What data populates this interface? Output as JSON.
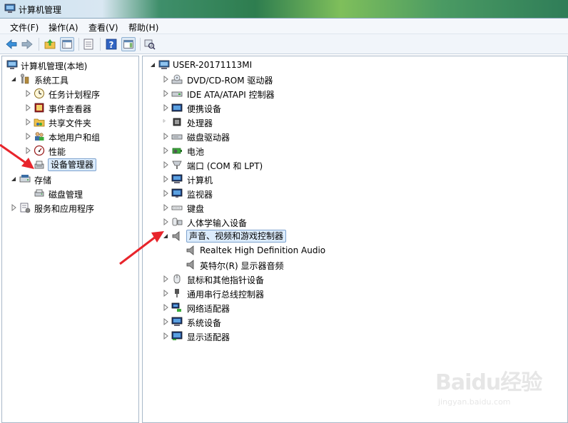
{
  "window": {
    "title": "计算机管理"
  },
  "menu": {
    "items": [
      "文件(F)",
      "操作(A)",
      "查看(V)",
      "帮助(H)"
    ]
  },
  "left_tree": {
    "root": "计算机管理(本地)",
    "system_tools": "系统工具",
    "task_scheduler": "任务计划程序",
    "event_viewer": "事件查看器",
    "shared_folders": "共享文件夹",
    "local_users_groups": "本地用户和组",
    "performance": "性能",
    "device_manager": "设备管理器",
    "storage": "存储",
    "disk_management": "磁盘管理",
    "services_apps": "服务和应用程序"
  },
  "device_tree": {
    "computer": "USER-20171113MI",
    "categories": [
      "DVD/CD-ROM 驱动器",
      "IDE ATA/ATAPI 控制器",
      "便携设备",
      "处理器",
      "磁盘驱动器",
      "电池",
      "端口 (COM 和 LPT)",
      "计算机",
      "监视器",
      "键盘",
      "人体学输入设备",
      "声音、视频和游戏控制器",
      "鼠标和其他指针设备",
      "通用串行总线控制器",
      "网络适配器",
      "系统设备",
      "显示适配器"
    ],
    "sound_children": [
      "Realtek High Definition Audio",
      "英特尔(R) 显示器音频"
    ]
  },
  "watermark": {
    "main": "Baidu经验",
    "sub": "jingyan.baidu.com"
  },
  "colors": {
    "selection": "#dcecfc",
    "selection_border": "#7da2ce",
    "arrow": "#e8242b"
  }
}
